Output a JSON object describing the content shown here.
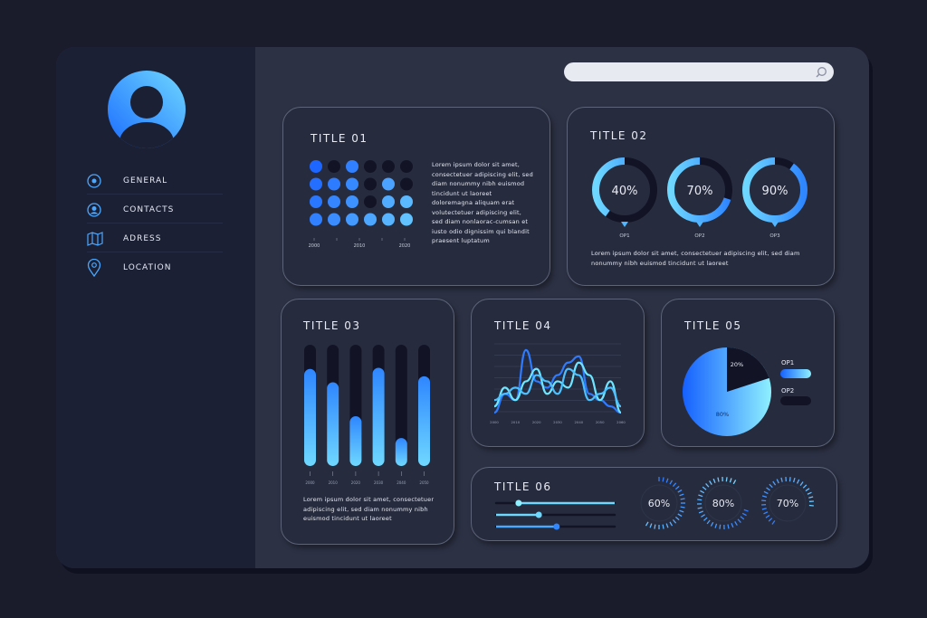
{
  "search": {
    "placeholder": ""
  },
  "sidebar": {
    "items": [
      {
        "label": "GENERAL",
        "icon": "radio-icon"
      },
      {
        "label": "CONTACTS",
        "icon": "user-icon"
      },
      {
        "label": "ADRESS",
        "icon": "map-icon"
      },
      {
        "label": "LOCATION",
        "icon": "pin-icon"
      }
    ]
  },
  "colors": {
    "accent": "#3b8bff",
    "light": "#6fe0ff",
    "dark": "#121426"
  },
  "card1": {
    "title": "TITLE 01",
    "text": "Lorem ipsum dolor sit amet, consectetuer adipiscing elit, sed diam nonummy nibh euismod tincidunt ut laoreet doloremagna aliquam erat volutectetuer adipiscing elit, sed diam nonlaorac-cumsan et iusto odio dignissim qui blandit praesent luptatum",
    "axis": [
      "2000",
      "2010",
      "2020"
    ],
    "filled_dots_per_column": [
      4,
      3,
      4,
      1,
      3,
      2
    ]
  },
  "card2": {
    "title": "TITLE 02",
    "donuts": [
      {
        "label": "OP1",
        "value": 40
      },
      {
        "label": "OP2",
        "value": 70
      },
      {
        "label": "OP3",
        "value": 90
      }
    ],
    "text": "Lorem ipsum dolor sit amet, consectetuer adipiscing elit, sed diam nonummy nibh euismod tincidunt ut laoreet"
  },
  "card3": {
    "title": "TITLE 03",
    "bars": [
      {
        "label": "2000",
        "value": 0.8
      },
      {
        "label": "2010",
        "value": 0.69
      },
      {
        "label": "2020",
        "value": 0.41
      },
      {
        "label": "2030",
        "value": 0.81
      },
      {
        "label": "2040",
        "value": 0.23
      },
      {
        "label": "2050",
        "value": 0.74
      }
    ],
    "text": "Lorem ipsum dolor sit amet, consectetuer adipiscing elit, sed diam nonummy nibh euismod tincidunt ut laoreet"
  },
  "card4": {
    "title": "TITLE 04",
    "x": [
      "2000",
      "2010",
      "2020",
      "2030",
      "2040",
      "2050",
      "2060"
    ],
    "series": [
      [
        0,
        3,
        2,
        10,
        5,
        4,
        6,
        8,
        9,
        3,
        2,
        1,
        0
      ],
      [
        1,
        4,
        2,
        5,
        7,
        3,
        5,
        4,
        8,
        6,
        2,
        5,
        0
      ],
      [
        2,
        3,
        4,
        3,
        6,
        5,
        3,
        7,
        6,
        2,
        3,
        4,
        1
      ]
    ],
    "ylim": [
      0,
      11
    ]
  },
  "card5": {
    "title": "TITLE 05",
    "slices": [
      {
        "label": "OP1",
        "value": 80,
        "text": "80%"
      },
      {
        "label": "OP2",
        "value": 20,
        "text": "20%"
      }
    ]
  },
  "card6": {
    "title": "TITLE 06",
    "sliders": [
      0.19,
      0.36,
      0.51
    ],
    "gauges": [
      {
        "value": 60,
        "text": "60%"
      },
      {
        "value": 80,
        "text": "80%"
      },
      {
        "value": 70,
        "text": "70%"
      }
    ]
  }
}
